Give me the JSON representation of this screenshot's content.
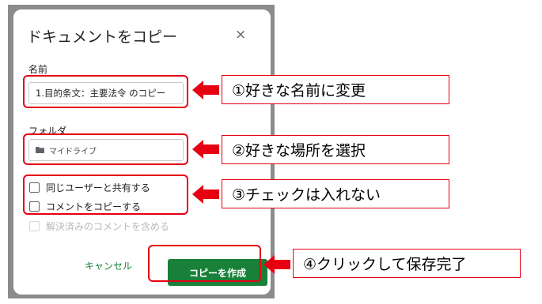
{
  "dialog": {
    "title": "ドキュメントをコピー",
    "close_glyph": "×",
    "name_label": "名前",
    "name_value": "1.目的条文：主要法令 のコピー",
    "folder_label": "フォルダ",
    "folder_value": "マイドライブ",
    "options": [
      {
        "label": "同じユーザーと共有する",
        "checked": false
      },
      {
        "label": "コメントをコピーする",
        "checked": false
      },
      {
        "label": "解決済みのコメントを含める",
        "checked": false,
        "disabled": true
      }
    ],
    "cancel_label": "キャンセル",
    "create_label": "コピーを作成"
  },
  "annotations": [
    {
      "text": "①好きな名前に変更"
    },
    {
      "text": "②好きな場所を選択"
    },
    {
      "text": "③チェックは入れない"
    },
    {
      "text": "④クリックして保存完了"
    }
  ],
  "colors": {
    "accent_green": "#188038",
    "highlight_red": "#e60012"
  }
}
